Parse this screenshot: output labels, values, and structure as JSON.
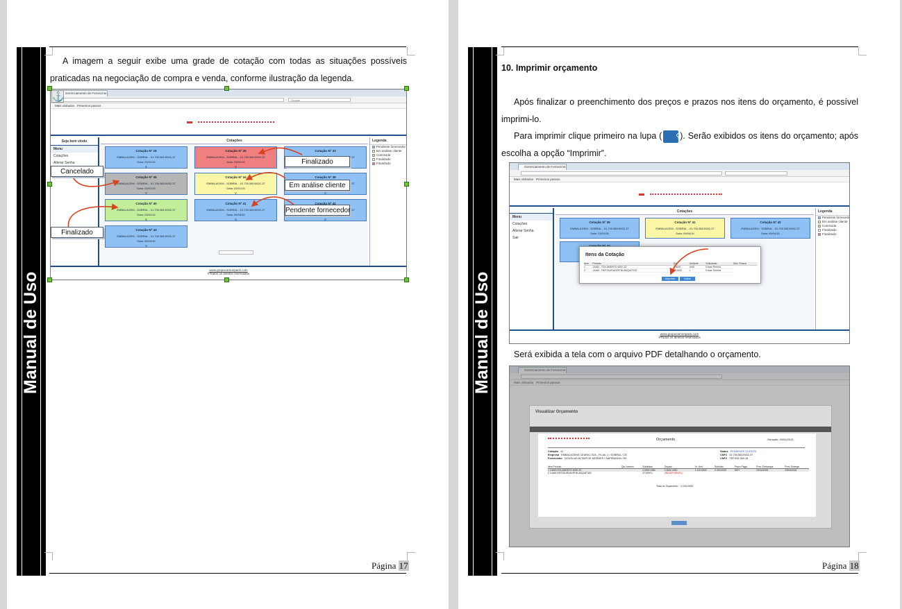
{
  "left_page": {
    "side_label": "Manual de Uso",
    "intro_text": "A imagem a seguir exibe uma grade de cotação com todas as situações possíveis praticadas na negociação de compra e venda, conforme ilustração da legenda.",
    "page_label": "Página",
    "page_number": "17",
    "screenshot": {
      "browser_tab": "Gerenciamento de Fornecime...",
      "bookmarks": [
        "Mais visitados",
        "Primeiros passos"
      ],
      "search_placeholder": "Google",
      "sidebar_welcome": "Seja bem vindo",
      "sidebar_items": [
        "Menu",
        "Cotações",
        "Alterar Senha"
      ],
      "main_title": "Cotações",
      "legend_title": "Legenda",
      "legend_items": [
        {
          "label": "Pendente fornecedor",
          "color": "#8fc1f5"
        },
        {
          "label": "Em análise cliente",
          "color": "#fbf7a6"
        },
        {
          "label": "Concluída",
          "color": "#c3ef9d"
        },
        {
          "label": "Finalizado",
          "color": "#ffffff"
        },
        {
          "label": "Finalizado",
          "color": "#f07f7f"
        }
      ],
      "cards": [
        {
          "title": "Cotação Nº 19",
          "line": "EMBALAGEM - SOBRAL - 01.700.581/0002-37",
          "date": "Data: 23/01/15",
          "icon": "search-icon"
        },
        {
          "title": "Cotação Nº 20",
          "line": "EMBALAGEM - SOBRAL - 01.700.581/0002-37",
          "date": "Data: 23/01/15",
          "icon": "search-icon"
        },
        {
          "title": "Cotação Nº 33",
          "line": "EMBALAGEM - SOBRAL - 01.700.581/0002-37",
          "date": "Data: 23/01/15",
          "icon": "search-icon"
        },
        {
          "title": "Cotação Nº 35",
          "line": "EMBALAGEM - SOBRAL - 01.700.581/0002-37",
          "date": "Data: 23/01/15",
          "icon": "search-icon"
        },
        {
          "title": "Cotação Nº 34",
          "line": "EMBALAGEM - SOBRAL - 01.700.581/0002-37",
          "date": "Data: 23/01/15",
          "icon": "search-icon"
        },
        {
          "title": "Cotação Nº 39",
          "line": "EMBALAGEM - SOBRAL - 01.700.581/0002-37",
          "date": "Data: 23/01/15",
          "icon": "search-icon"
        },
        {
          "title": "Cotação Nº 40",
          "line": "EMBALAGEM - SOBRAL - 01.700.581/0002-37",
          "date": "Data: 23/01/15",
          "icon": "search-icon"
        },
        {
          "title": "Cotação Nº 41",
          "line": "EMBALAGEM - SOBRAL - 01.700.581/0002-37",
          "date": "Data: 09/04/15",
          "icon": "search-icon"
        },
        {
          "title": "Cotação Nº 42",
          "line": "EMBALAGEM - SOBRAL - 01.700.581/0002-37",
          "date": "Data: 09/04/15",
          "icon": "search-icon"
        },
        {
          "title": "Cotação Nº 43",
          "line": "EMBALAGEM - SOBRAL - 01.700.581/0002-37",
          "date": "Data: 09/04/15",
          "icon": "search-icon"
        }
      ],
      "footer_link": "www.grupocarrionpack.com",
      "footer_rights": "®Todos os direitos reservados"
    },
    "callouts": {
      "finalizado_top": "Finalizado",
      "cancelado": "Cancelado",
      "em_analise": "Em análise cliente",
      "pendente": "Pendente fornecedor",
      "finalizado_bottom": "Finalizado"
    }
  },
  "right_page": {
    "side_label": "Manual de Uso",
    "heading": "10. Imprimir orçamento",
    "para1": "Após finalizar o preenchimento dos preços e prazos nos itens do orçamento, é possível imprimi-lo.",
    "para2_before": "Para imprimir clique primeiro na lupa (",
    "para2_after": "). Serão exibidos os itens do orçamento; após escolha a opção “Imprimir”.",
    "para3": "Será exibida a tela com o arquivo PDF detalhando o orçamento.",
    "page_label": "Página",
    "page_number": "18",
    "screenshot1": {
      "browser_tab": "Gerenciamento de Fornecime...",
      "bookmarks": [
        "Mais visitados",
        "Primeiros passos"
      ],
      "sidebar_items": [
        "Menu",
        "Cotações",
        "Alterar Senha",
        "Sair"
      ],
      "main_title": "Cotações",
      "legend_title": "Legenda",
      "legend_items": [
        {
          "label": "Pendente fornecedor",
          "color": "#8fc1f5"
        },
        {
          "label": "Em análise cliente",
          "color": "#fbf7a6"
        },
        {
          "label": "Concluída",
          "color": "#c3ef9d"
        },
        {
          "label": "Finalizado",
          "color": "#ffffff"
        },
        {
          "label": "Finalizado",
          "color": "#f07f7f"
        }
      ],
      "cards": [
        {
          "title": "Cotação Nº 39",
          "line": "EMBALAGEM - SOBRAL - 01.700.581/0002-37",
          "date": "Data: 23/01/15"
        },
        {
          "title": "Cotação Nº 41",
          "line": "EMBALAGEM - SOBRAL - 01.700.581/0002-37",
          "date": "Data: 09/04/15"
        },
        {
          "title": "Cotação Nº 42",
          "line": "EMBALAGEM - SOBRAL - 01.700.581/0002-37",
          "date": "Data: 09/04/15"
        },
        {
          "title": "Cotação Nº 43",
          "line": "",
          "date": ""
        }
      ],
      "modal_title": "Itens da Cotação",
      "modal_columns": [
        "Item",
        "Produto",
        "Qtd",
        "Unidade",
        "Solicitante",
        "Obs. Prazos"
      ],
      "modal_rows": [
        [
          "1",
          "14460 - ROLAMENTO 6000 ZZ",
          "2,0000",
          "UND",
          "Eduar Pereira"
        ],
        [
          "2",
          "14460 - RESTAURADOR BLANQUETAS",
          "47,0000",
          "L",
          "Eduar Pereira"
        ]
      ],
      "btn_print": "Imprimir",
      "btn_back": "Voltar",
      "footer_link": "www.grupocarrionpack.com",
      "footer_rights": "®Todos os direitos reservados"
    },
    "screenshot2": {
      "browser_tab": "Gerenciamento de Fornecime...",
      "bookmarks": [
        "Mais visitados",
        "Primeiros passos"
      ],
      "visualizar_title": "Visualizar Orçamento",
      "pdf": {
        "title": "Orçamento",
        "geracao": "Geração: 24/04/2015",
        "cotacao_label": "Cotação",
        "cotacao_value": "41",
        "empresa_label": "Empresa",
        "empresa_value": "EMBALAGENS CEARA LTDA - FILIAL 1 / SOBRAL / CE",
        "fornecedor_label": "Fornecedor",
        "fornecedor_value": "DOUGLAS ALTAIR DE MORAES / SAPIRANGA / RS",
        "status_label": "Status",
        "status_value": "PENDENTE CLIENTE",
        "cnpj_label": "CNPJ",
        "cnpj_value": "01.700.581/0002-37",
        "cnpj2_label": "CNPJ",
        "cnpj2_value": "TEF.926.300-18",
        "columns": [
          "Item Produto",
          "Qtd. Interno",
          "Solicitado",
          "Orçado",
          "Vr. Unit.",
          "Subtotal",
          "Prazo Pagto",
          "Prev. Embarque",
          "Prev. Entrega"
        ],
        "rows": [
          [
            "1 14460-ROLAMENTO 6000 ZZ",
            "",
            "2,0000 UND",
            "2,0000 UND",
            "1.110,0000",
            "2.220,0000",
            "0/0/7",
            "23/04/2015",
            "23/04/2015"
          ],
          [
            "2 14460-RESTAURADOR BLANQUETAS",
            "",
            "47,0000 L",
            "(INDISPONÍVEL)",
            "",
            "",
            "",
            "",
            ""
          ]
        ],
        "total_label": "Total do Orçamento",
        "total_value": "2.220,0000"
      }
    }
  },
  "colors": {
    "sidebar_black": "#000000",
    "navy": "#1f4e8c",
    "card_blue": "#8fc1f5",
    "card_red": "#f07f7f",
    "card_gray": "#b6b6b6",
    "card_yellow": "#fbf7a6",
    "card_green": "#c3ef9d",
    "arrow_red": "#d9421f"
  }
}
